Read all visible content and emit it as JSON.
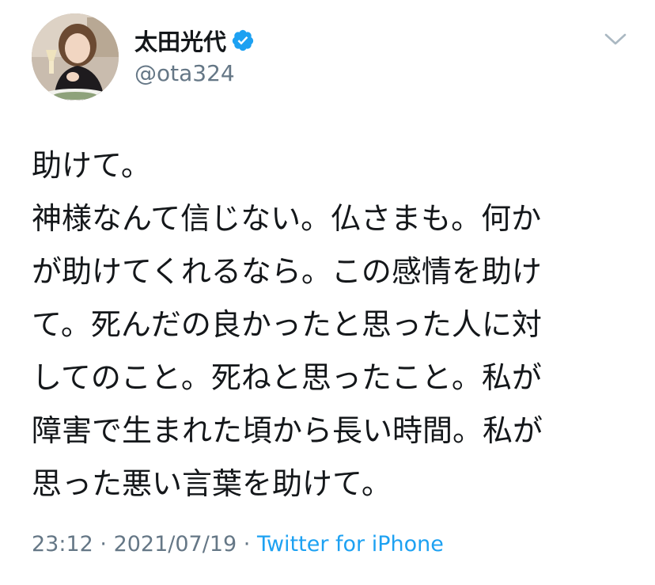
{
  "author": {
    "display_name": "太田光代",
    "handle": "@ota324",
    "verified": true,
    "verified_icon": "verified-badge-icon"
  },
  "tweet": {
    "lines": [
      "助けて。",
      "神様なんて信じない。仏さまも。何か",
      "が助けてくれるなら。この感情を助け",
      "て。死んだの良かったと思った人に対",
      "してのこと。死ねと思ったこと。私が",
      "障害で生まれた頃から長い時間。私が",
      "思った悪い言葉を助けて。"
    ]
  },
  "meta": {
    "time": "23:12",
    "separator": " · ",
    "date": "2021/07/19",
    "source": "Twitter for iPhone"
  },
  "menu": {
    "icon": "chevron-down-icon"
  },
  "colors": {
    "text": "#14171a",
    "secondary": "#657786",
    "link": "#1da1f2",
    "verified": "#1da1f2",
    "chevron": "#aab8c2"
  }
}
